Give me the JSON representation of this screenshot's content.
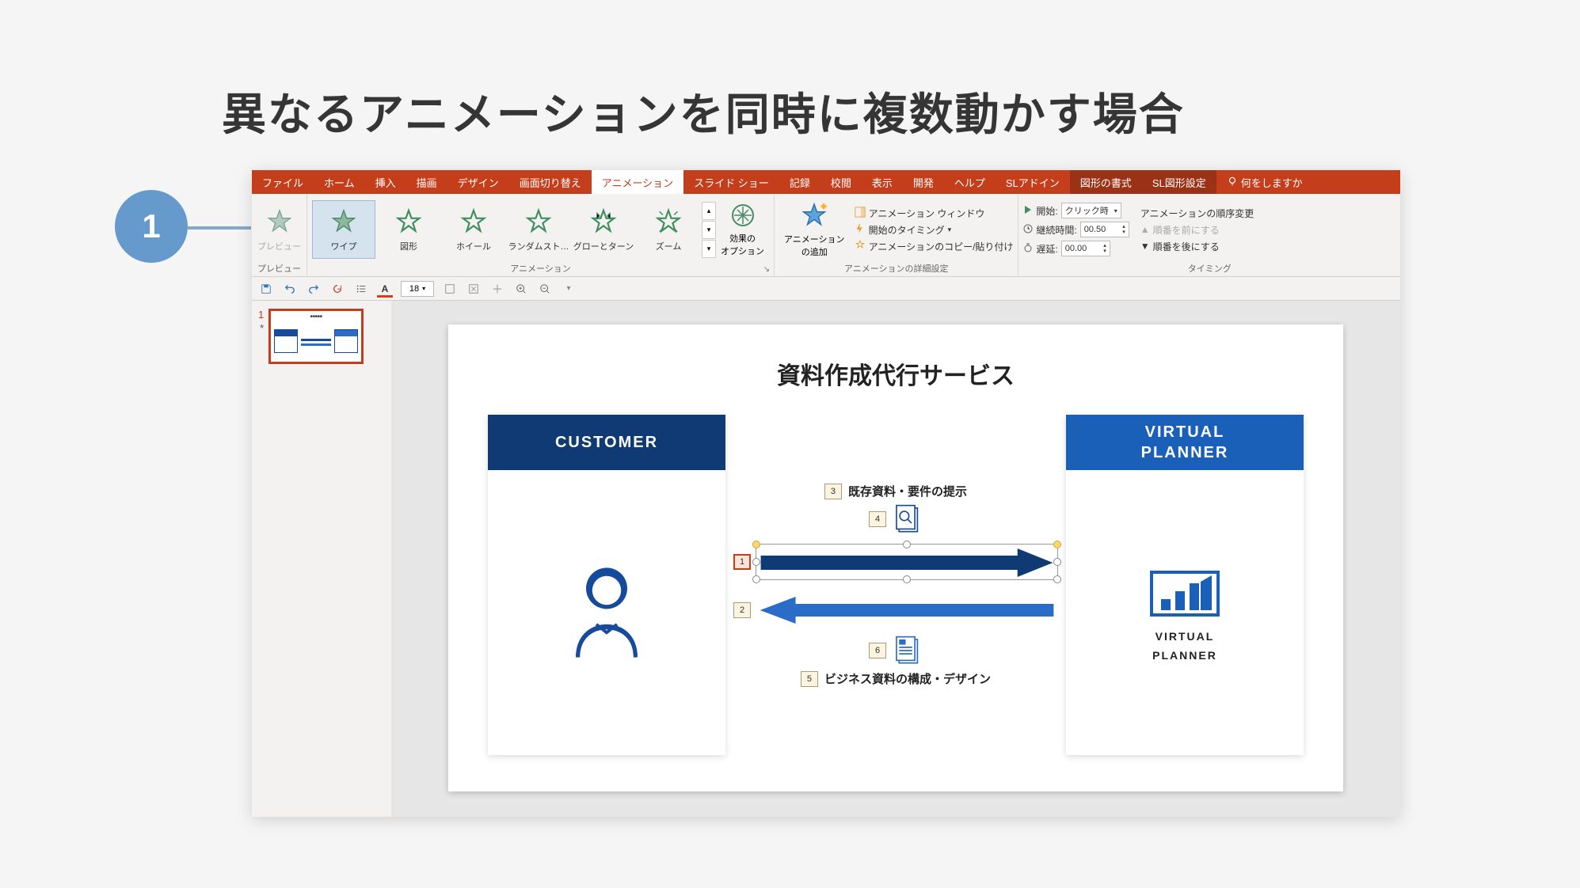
{
  "page_title": "異なるアニメーションを同時に複数動かす場合",
  "step_number": "1",
  "ribbon": {
    "tabs": {
      "file": "ファイル",
      "home": "ホーム",
      "insert": "挿入",
      "draw": "描画",
      "design": "デザイン",
      "transitions": "画面切り替え",
      "animations": "アニメーション",
      "slideshow": "スライド ショー",
      "record": "記録",
      "review": "校閲",
      "view": "表示",
      "developer": "開発",
      "help": "ヘルプ",
      "sladdin": "SLアドイン",
      "shape_format": "図形の書式",
      "sl_shape_settings": "SL図形設定",
      "tell_me": "何をしますか"
    },
    "preview_group": {
      "label": "プレビュー",
      "button": "プレビュー"
    },
    "anim_group": {
      "label": "アニメーション",
      "items": {
        "wipe": "ワイプ",
        "shape": "図形",
        "wheel": "ホイール",
        "random": "ランダムスト…",
        "grow_turn": "グローとターン",
        "zoom": "ズーム"
      },
      "effect_options": "効果の\nオプション"
    },
    "adv_group": {
      "label": "アニメーションの詳細設定",
      "add_animation": "アニメーション\nの追加",
      "animation_pane": "アニメーション ウィンドウ",
      "trigger": "開始のタイミング",
      "painter": "アニメーションのコピー/貼り付け"
    },
    "timing_group": {
      "label": "タイミング",
      "start_label": "開始:",
      "start_value": "クリック時",
      "duration_label": "継続時間:",
      "duration_value": "00.50",
      "delay_label": "遅延:",
      "delay_value": "00.00",
      "reorder_label": "アニメーションの順序変更",
      "move_earlier": "順番を前にする",
      "move_later": "順番を後にする"
    }
  },
  "qat": {
    "font_size": "18"
  },
  "thumbnail": {
    "number": "1",
    "star": "*"
  },
  "slide": {
    "title": "資料作成代行サービス",
    "customer": "CUSTOMER",
    "vp_line1": "VIRTUAL",
    "vp_line2": "PLANNER",
    "top_label": "既存資料・要件の提示",
    "bottom_label": "ビジネス資料の構成・デザイン",
    "tags": {
      "t1": "1",
      "t2": "2",
      "t3": "3",
      "t4": "4",
      "t5": "5",
      "t6": "6"
    },
    "logo1": "VIRTUAL",
    "logo2": "PLANNER"
  }
}
